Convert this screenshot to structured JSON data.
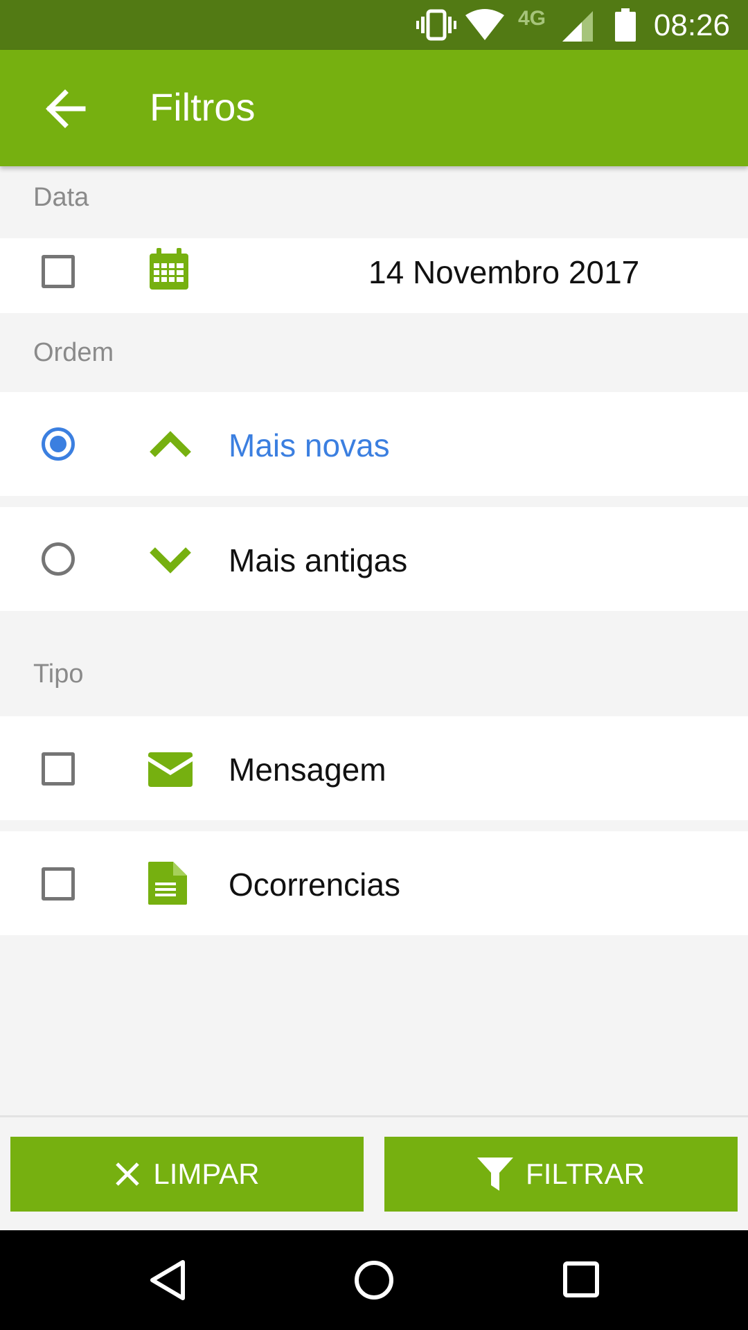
{
  "status_bar": {
    "time": "08:26",
    "network": "4G"
  },
  "app_bar": {
    "title": "Filtros"
  },
  "sections": {
    "date": {
      "label": "Data",
      "value": "14 Novembro 2017"
    },
    "order": {
      "label": "Ordem",
      "options": [
        {
          "label": "Mais novas",
          "selected": true
        },
        {
          "label": "Mais antigas",
          "selected": false
        }
      ]
    },
    "type": {
      "label": "Tipo",
      "options": [
        {
          "label": "Mensagem",
          "checked": false
        },
        {
          "label": "Ocorrencias",
          "checked": false
        }
      ]
    }
  },
  "buttons": {
    "clear": "LIMPAR",
    "filter": "FILTRAR"
  },
  "colors": {
    "primary": "#76b010",
    "status_bar": "#527a14",
    "selected": "#3b7fe0"
  }
}
